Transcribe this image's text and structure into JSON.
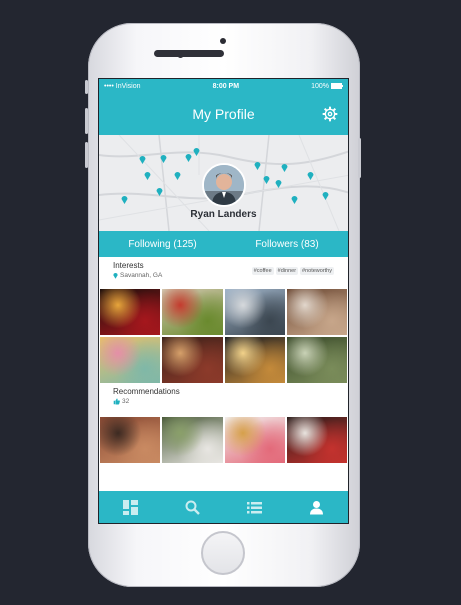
{
  "status": {
    "carrier": "•••• InVision",
    "time": "8:00 PM",
    "battery": "100%"
  },
  "header": {
    "title": "My Profile",
    "settings_icon": "gear-icon"
  },
  "profile": {
    "name": "Ryan Landers"
  },
  "follow": {
    "following": "Following (125)",
    "followers": "Followers (83)"
  },
  "interests": {
    "title": "Interests",
    "location": "Savannah, GA",
    "tags": [
      "#coffee",
      "#dinner",
      "#noteworthy"
    ]
  },
  "recommendations": {
    "title": "Recommendations",
    "count": "32"
  },
  "photos": [
    {
      "name": "pizza-sign-photo",
      "colors": [
        "#1d0f0c",
        "#a5171d",
        "#e7a53b"
      ]
    },
    {
      "name": "salad-bowl-photo",
      "colors": [
        "#d3c7b0",
        "#6a8a2e",
        "#c43b2e"
      ]
    },
    {
      "name": "food-truck-photo",
      "colors": [
        "#9fb3c8",
        "#3b4650",
        "#d6d9dc"
      ]
    },
    {
      "name": "drinks-table-photo",
      "colors": [
        "#6d4a35",
        "#c7a68a",
        "#e2d7cc"
      ]
    },
    {
      "name": "macarons-photo",
      "colors": [
        "#e8c06a",
        "#7fb8a8",
        "#e48fa8"
      ]
    },
    {
      "name": "restaurant-interior-photo",
      "colors": [
        "#3b2019",
        "#8c3a2a",
        "#d6a06a"
      ]
    },
    {
      "name": "storefront-night-photo",
      "colors": [
        "#1a1c22",
        "#c48a3a",
        "#f2d28a"
      ]
    },
    {
      "name": "oak-avenue-photo",
      "colors": [
        "#3a4a2a",
        "#7a8c5a",
        "#c9d2b6"
      ]
    }
  ],
  "rec_photos": [
    {
      "name": "brick-wall-photo",
      "colors": [
        "#8a4a34",
        "#c98a62",
        "#3c2a22"
      ]
    },
    {
      "name": "street-cafe-photo",
      "colors": [
        "#4a5a3a",
        "#e8e6e2",
        "#8aa06a"
      ]
    },
    {
      "name": "donut-photo",
      "colors": [
        "#f2f0ee",
        "#e36a7a",
        "#d6a04a"
      ]
    },
    {
      "name": "neon-diner-photo",
      "colors": [
        "#2a1c1a",
        "#c4322e",
        "#e9e4df"
      ]
    }
  ],
  "tabs": [
    {
      "name": "tab-dashboard",
      "icon": "dashboard-icon"
    },
    {
      "name": "tab-search",
      "icon": "search-icon"
    },
    {
      "name": "tab-list",
      "icon": "list-icon"
    },
    {
      "name": "tab-profile",
      "icon": "user-icon"
    }
  ]
}
